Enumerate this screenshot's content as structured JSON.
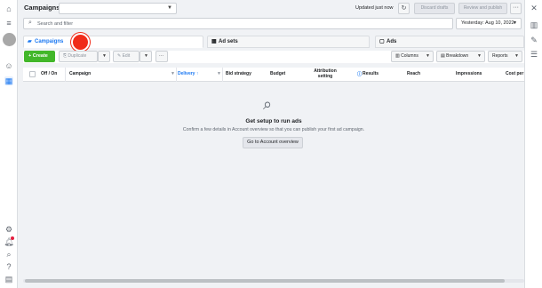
{
  "left_rail": {
    "icons": [
      "home-icon",
      "menu-icon",
      "avatar",
      "smile-icon",
      "grid-icon",
      "gear-icon",
      "bell-icon",
      "search-icon",
      "help-icon",
      "ledger-icon"
    ]
  },
  "right_rail": {
    "icons": [
      "close-icon",
      "chart-icon",
      "pencil-icon",
      "sliders-icon"
    ]
  },
  "header": {
    "title": "Campaigns",
    "status": "Updated just now",
    "discard_label": "Discard drafts",
    "review_label": "Review and publish",
    "more": "···"
  },
  "search": {
    "placeholder": "Search and filter",
    "date_label": "Yesterday: Aug 10, 2022"
  },
  "tabs": [
    {
      "label": "Campaigns",
      "icon": "folder-icon",
      "active": true
    },
    {
      "label": "Ad sets",
      "icon": "grid-icon",
      "active": false
    },
    {
      "label": "Ads",
      "icon": "square-icon",
      "active": false
    }
  ],
  "toolbar": {
    "create": "+ Create",
    "duplicate": "Duplicate",
    "edit": "Edit",
    "more": "···",
    "columns": "Columns",
    "breakdown": "Breakdown",
    "reports": "Reports"
  },
  "table": {
    "columns": [
      {
        "label": "Off / On"
      },
      {
        "label": "Campaign"
      },
      {
        "label": "Delivery ↑",
        "sorted": true
      },
      {
        "label": "Bid strategy"
      },
      {
        "label": "Budget"
      },
      {
        "label": "Attribution setting"
      },
      {
        "label": "Results"
      },
      {
        "label": "Reach"
      },
      {
        "label": "Impressions"
      },
      {
        "label": "Cost per"
      }
    ]
  },
  "empty_state": {
    "title": "Get setup to run ads",
    "subtitle": "Confirm a few details in Account overview so that you can publish your first ad campaign.",
    "button": "Go to Account overview"
  },
  "colors": {
    "accent": "#1877f2",
    "create_green": "#42b72a",
    "cursor_red": "#f02c1a"
  }
}
